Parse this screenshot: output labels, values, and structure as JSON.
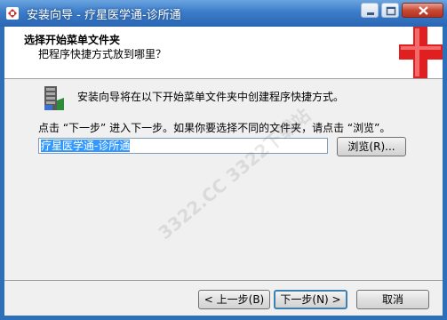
{
  "window": {
    "title": "安装向导 - 疗星医学通-诊所通",
    "controls": [
      "minimize",
      "maximize",
      "close"
    ]
  },
  "header": {
    "title": "选择开始菜单文件夹",
    "subtitle": "把程序快捷方式放到哪里？"
  },
  "body": {
    "description": "安装向导将在以下开始菜单文件夹中创建程序快捷方式。",
    "instruction": "点击 “下一步” 进入下一步。如果你要选择不同的文件夹，请点击 “浏览”。",
    "folder_value": "疗星医学通-诊所通",
    "browse_label": "浏览(R)..."
  },
  "footer": {
    "back_label": "< 上一步(B)",
    "next_label": "下一步(N) >",
    "cancel_label": "取消"
  },
  "watermark": "3322.CC 3322下载站",
  "colors": {
    "titlebar": "#3c7cc9",
    "client_bg": "#f0f0f0",
    "selection": "#3399ff",
    "logo_red": "#e02020"
  }
}
